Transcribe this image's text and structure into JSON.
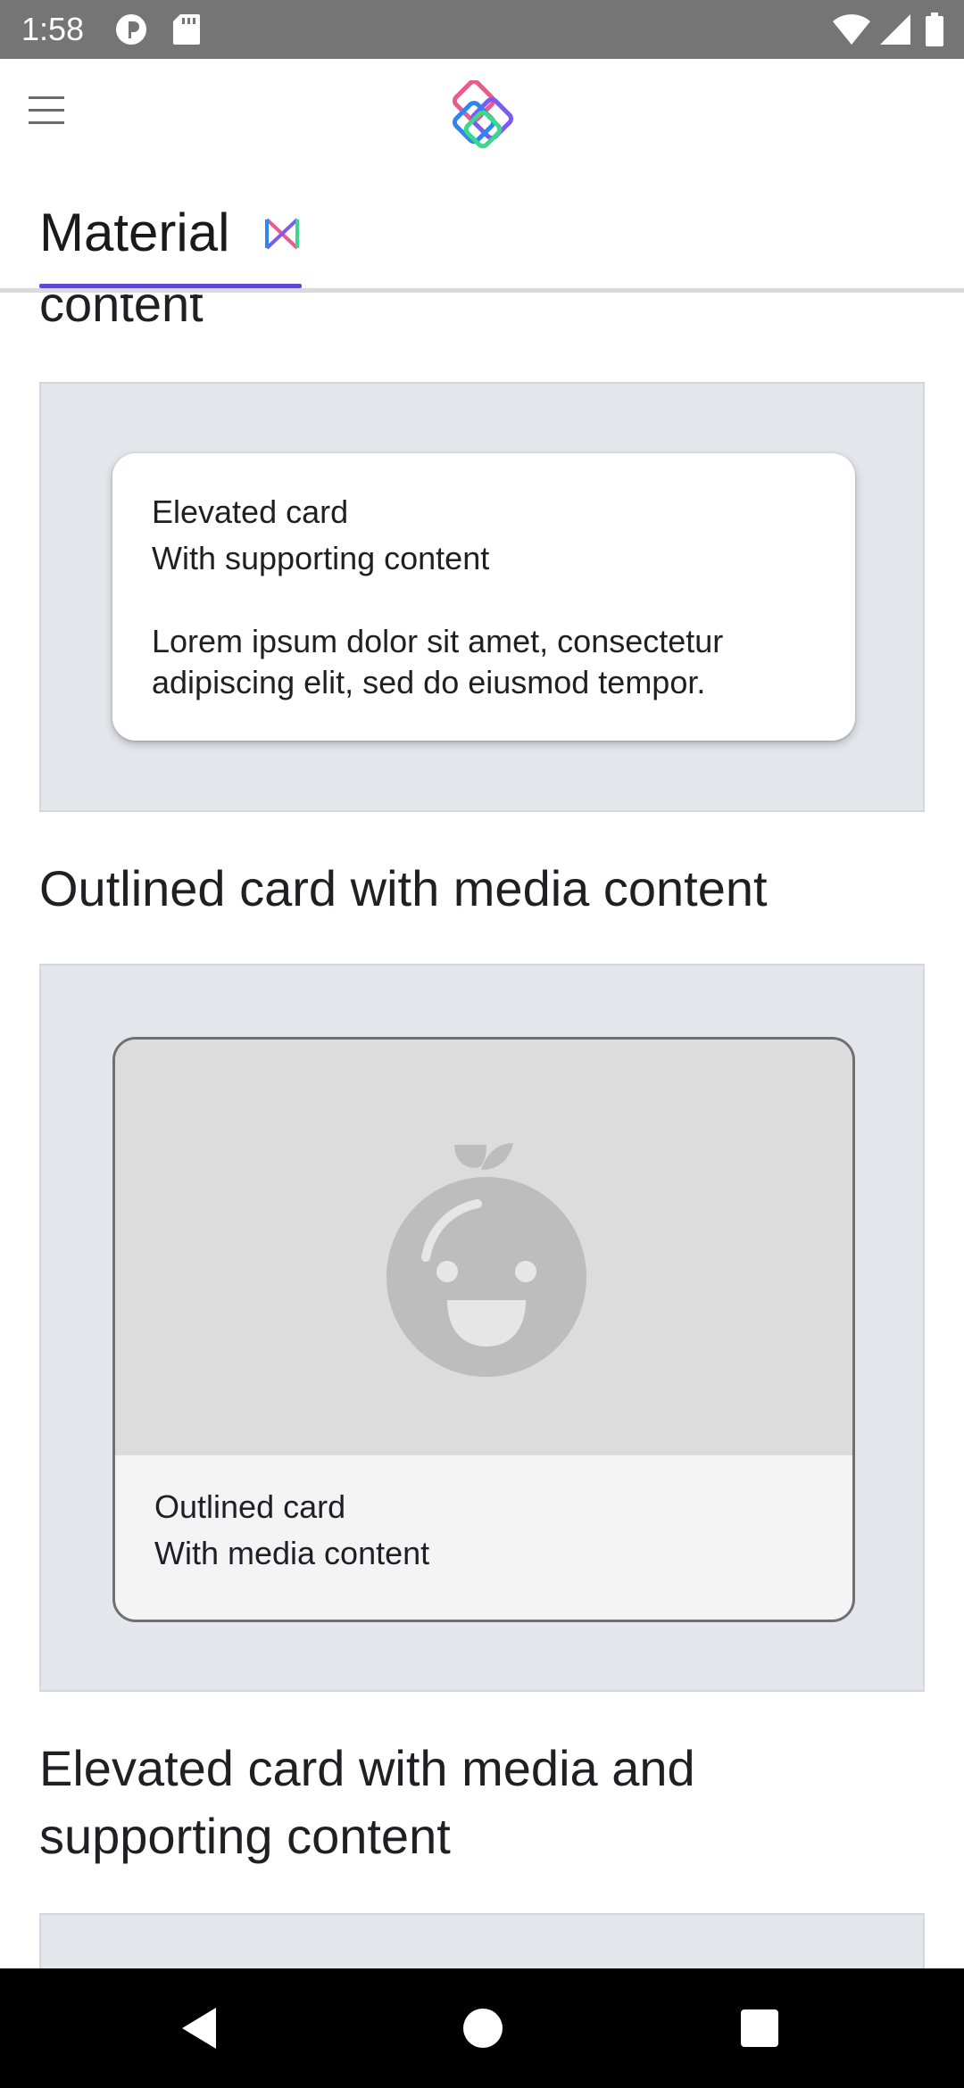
{
  "status_bar": {
    "time": "1:58",
    "icons": [
      "pocket-casts-icon",
      "sd-card-icon",
      "wifi-icon",
      "cell-signal-icon",
      "battery-icon"
    ]
  },
  "top_bar": {
    "menu_icon": "hamburger-menu-icon",
    "logo_icon": "compose-catalog-logo-icon",
    "tabs": [
      {
        "label": "Material",
        "icon": "material-logo-icon",
        "selected": true
      }
    ]
  },
  "colors": {
    "tab_indicator": "#5c4ad6",
    "panel_background": "#e3e6ea",
    "outlined_card_border": "#6e6e73",
    "media_placeholder": "#dcdcdc"
  },
  "content": {
    "partial_heading": "content",
    "elevated_card": {
      "title": "Elevated card",
      "subtitle": "With supporting content",
      "body": "Lorem ipsum dolor sit amet, consectetur adipiscing elit, sed do eiusmod tempor."
    },
    "outlined_section": {
      "heading": "Outlined card with media content",
      "card": {
        "media_icon": "smiling-fruit-placeholder-icon",
        "title": "Outlined card",
        "subtitle": "With media content"
      }
    },
    "elevated_media_section": {
      "heading": "Elevated card with media and supporting content"
    }
  },
  "nav_bar": {
    "buttons": [
      "back-icon",
      "home-icon",
      "recents-icon"
    ]
  }
}
